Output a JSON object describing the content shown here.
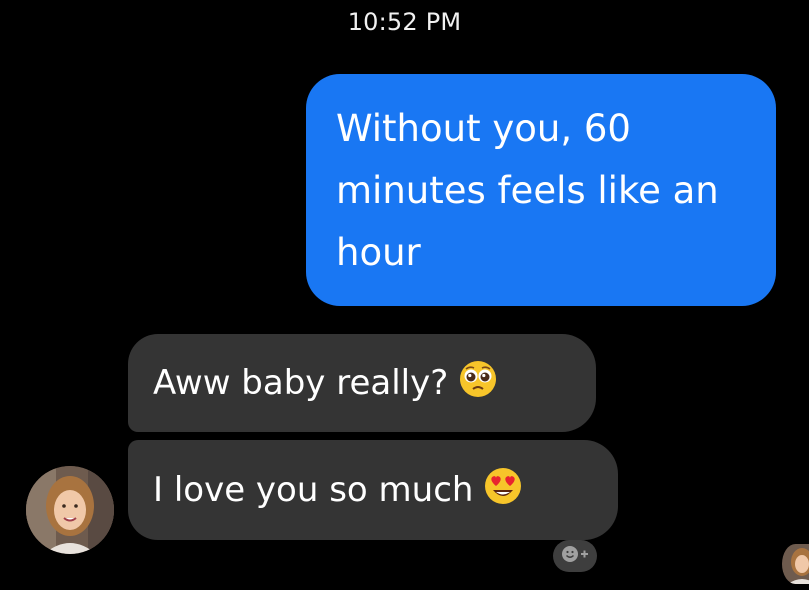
{
  "header": {
    "timestamp": "10:52 PM"
  },
  "messages": [
    {
      "direction": "outgoing",
      "lines": [
        "Without you, 60",
        "minutes feels like an",
        "hour"
      ],
      "color": "#1977f3"
    },
    {
      "direction": "incoming",
      "text": "Aww baby really?",
      "emoji": "pleading-face-icon",
      "color": "#343434"
    },
    {
      "direction": "incoming",
      "text": "I love you so much",
      "emoji": "heart-eyes-icon",
      "color": "#343434"
    }
  ],
  "icons": {
    "reaction": "add-reaction-icon",
    "avatar": "sender-avatar",
    "read_receipt": "read-receipt-avatar"
  }
}
